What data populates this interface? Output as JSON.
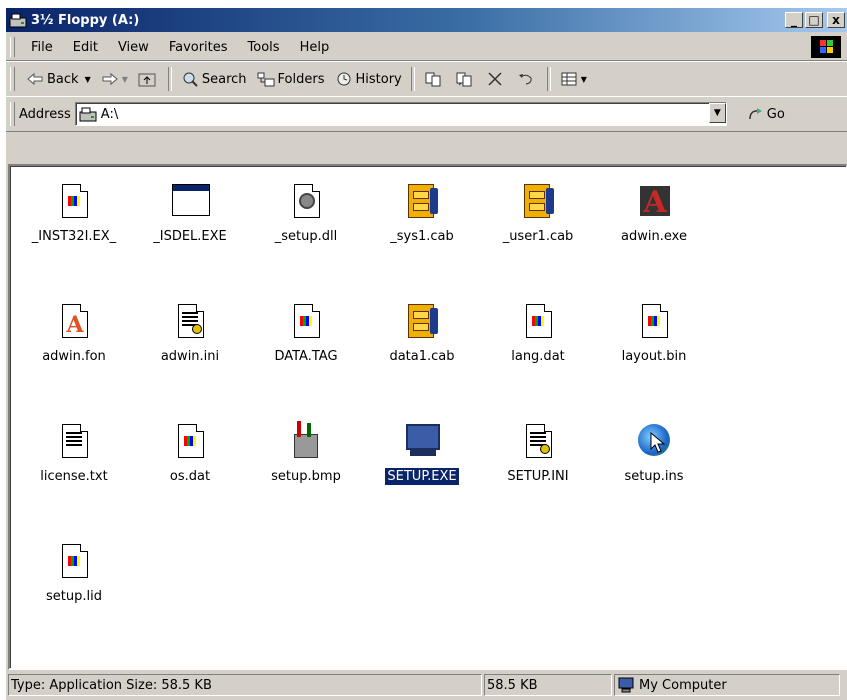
{
  "window": {
    "title": "3½ Floppy (A:)",
    "controls": [
      "_",
      "□",
      "x"
    ]
  },
  "menubar": {
    "items": [
      "File",
      "Edit",
      "View",
      "Favorites",
      "Tools",
      "Help"
    ]
  },
  "toolbar": {
    "back": "Back",
    "search": "Search",
    "folders": "Folders",
    "history": "History"
  },
  "address": {
    "label": "Address",
    "value": "A:\\",
    "go": "Go"
  },
  "files": [
    {
      "name": "_INST32I.EX_",
      "icon": "windows-flag-doc-icon"
    },
    {
      "name": "_ISDEL.EXE",
      "icon": "application-window-icon"
    },
    {
      "name": "_setup.dll",
      "icon": "dll-gear-icon"
    },
    {
      "name": "_sys1.cab",
      "icon": "cabinet-archive-icon"
    },
    {
      "name": "_user1.cab",
      "icon": "cabinet-archive-icon"
    },
    {
      "name": "adwin.exe",
      "icon": "adwin-a-icon"
    },
    {
      "name": "adwin.fon",
      "icon": "font-a-icon"
    },
    {
      "name": "adwin.ini",
      "icon": "ini-config-icon"
    },
    {
      "name": "DATA.TAG",
      "icon": "windows-flag-doc-icon"
    },
    {
      "name": "data1.cab",
      "icon": "cabinet-archive-icon"
    },
    {
      "name": "lang.dat",
      "icon": "windows-flag-doc-icon"
    },
    {
      "name": "layout.bin",
      "icon": "windows-flag-doc-icon"
    },
    {
      "name": "license.txt",
      "icon": "text-document-icon"
    },
    {
      "name": "os.dat",
      "icon": "windows-flag-doc-icon"
    },
    {
      "name": "setup.bmp",
      "icon": "paint-brushes-icon"
    },
    {
      "name": "SETUP.EXE",
      "icon": "setup-computer-icon",
      "selected": true
    },
    {
      "name": "SETUP.INI",
      "icon": "ini-config-icon"
    },
    {
      "name": "setup.ins",
      "icon": "globe-cursor-icon"
    },
    {
      "name": "setup.lid",
      "icon": "windows-flag-doc-icon"
    }
  ],
  "statusbar": {
    "info": "Type: Application Size: 58.5 KB",
    "size": "58.5 KB",
    "zone": "My Computer"
  }
}
